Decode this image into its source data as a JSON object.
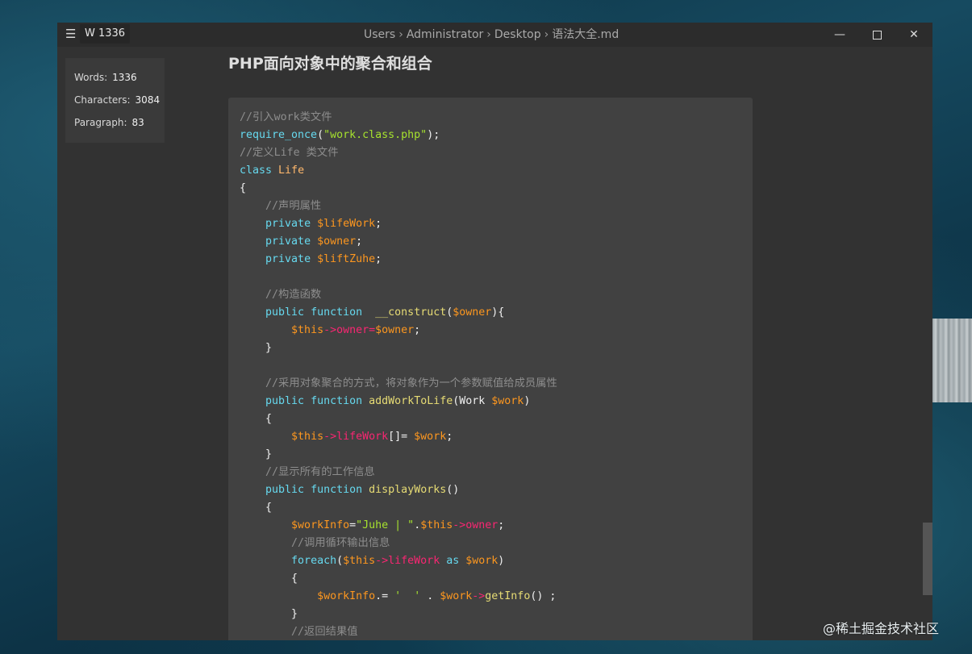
{
  "app": {
    "word_badge": "W 1336",
    "breadcrumb": [
      "Users",
      "Administrator",
      "Desktop",
      "语法大全.md"
    ],
    "breadcrumb_sep": "›"
  },
  "stats": {
    "words_label": "Words:",
    "words_value": "1336",
    "characters_label": "Characters:",
    "characters_value": "3084",
    "paragraph_label": "Paragraph:",
    "paragraph_value": "83"
  },
  "document": {
    "heading": "PHP面向对象中的聚合和组合",
    "code_lines": [
      [
        [
          "comment",
          "//引入work类文件"
        ]
      ],
      [
        [
          "keyword",
          "require_once"
        ],
        [
          "plain",
          "("
        ],
        [
          "string",
          "\"work.class.php\""
        ],
        [
          "plain",
          ");"
        ]
      ],
      [
        [
          "comment",
          "//定义Life 类文件"
        ]
      ],
      [
        [
          "keyword",
          "class"
        ],
        [
          "plain",
          " "
        ],
        [
          "class",
          "Life"
        ]
      ],
      [
        [
          "plain",
          "{"
        ]
      ],
      [
        [
          "plain",
          "    "
        ],
        [
          "comment",
          "//声明属性"
        ]
      ],
      [
        [
          "plain",
          "    "
        ],
        [
          "keyword",
          "private"
        ],
        [
          "plain",
          " "
        ],
        [
          "variable",
          "$lifeWork"
        ],
        [
          "plain",
          ";"
        ]
      ],
      [
        [
          "plain",
          "    "
        ],
        [
          "keyword",
          "private"
        ],
        [
          "plain",
          " "
        ],
        [
          "variable",
          "$owner"
        ],
        [
          "plain",
          ";"
        ]
      ],
      [
        [
          "plain",
          "    "
        ],
        [
          "keyword",
          "private"
        ],
        [
          "plain",
          " "
        ],
        [
          "variable",
          "$liftZuhe"
        ],
        [
          "plain",
          ";"
        ]
      ],
      [
        [
          "plain",
          ""
        ]
      ],
      [
        [
          "plain",
          "    "
        ],
        [
          "comment",
          "//构造函数"
        ]
      ],
      [
        [
          "plain",
          "    "
        ],
        [
          "keyword",
          "public"
        ],
        [
          "plain",
          " "
        ],
        [
          "keyword",
          "function"
        ],
        [
          "plain",
          "  "
        ],
        [
          "function",
          "__construct"
        ],
        [
          "plain",
          "("
        ],
        [
          "variable",
          "$owner"
        ],
        [
          "plain",
          "){"
        ]
      ],
      [
        [
          "plain",
          "        "
        ],
        [
          "variable",
          "$this"
        ],
        [
          "property",
          "->owner="
        ],
        [
          "variable",
          "$owner"
        ],
        [
          "plain",
          ";"
        ]
      ],
      [
        [
          "plain",
          "    }"
        ]
      ],
      [
        [
          "plain",
          ""
        ]
      ],
      [
        [
          "plain",
          "    "
        ],
        [
          "comment",
          "//采用对象聚合的方式，将对象作为一个参数赋值给成员属性"
        ]
      ],
      [
        [
          "plain",
          "    "
        ],
        [
          "keyword",
          "public"
        ],
        [
          "plain",
          " "
        ],
        [
          "keyword",
          "function"
        ],
        [
          "plain",
          " "
        ],
        [
          "function",
          "addWorkToLife"
        ],
        [
          "plain",
          "(Work "
        ],
        [
          "variable",
          "$work"
        ],
        [
          "plain",
          ")"
        ]
      ],
      [
        [
          "plain",
          "    {"
        ]
      ],
      [
        [
          "plain",
          "        "
        ],
        [
          "variable",
          "$this"
        ],
        [
          "property",
          "->lifeWork"
        ],
        [
          "plain",
          "[]= "
        ],
        [
          "variable",
          "$work"
        ],
        [
          "plain",
          ";"
        ]
      ],
      [
        [
          "plain",
          "    }"
        ]
      ],
      [
        [
          "plain",
          "    "
        ],
        [
          "comment",
          "//显示所有的工作信息"
        ]
      ],
      [
        [
          "plain",
          "    "
        ],
        [
          "keyword",
          "public"
        ],
        [
          "plain",
          " "
        ],
        [
          "keyword",
          "function"
        ],
        [
          "plain",
          " "
        ],
        [
          "function",
          "displayWorks"
        ],
        [
          "plain",
          "()"
        ]
      ],
      [
        [
          "plain",
          "    {"
        ]
      ],
      [
        [
          "plain",
          "        "
        ],
        [
          "variable",
          "$workInfo"
        ],
        [
          "plain",
          "="
        ],
        [
          "string",
          "\"Juhe | \""
        ],
        [
          "plain",
          "."
        ],
        [
          "variable",
          "$this"
        ],
        [
          "property",
          "->owner"
        ],
        [
          "plain",
          ";"
        ]
      ],
      [
        [
          "plain",
          "        "
        ],
        [
          "comment",
          "//调用循环输出信息"
        ]
      ],
      [
        [
          "plain",
          "        "
        ],
        [
          "keyword",
          "foreach"
        ],
        [
          "plain",
          "("
        ],
        [
          "variable",
          "$this"
        ],
        [
          "property",
          "->lifeWork"
        ],
        [
          "plain",
          " "
        ],
        [
          "keyword",
          "as"
        ],
        [
          "plain",
          " "
        ],
        [
          "variable",
          "$work"
        ],
        [
          "plain",
          ")"
        ]
      ],
      [
        [
          "plain",
          "        {"
        ]
      ],
      [
        [
          "plain",
          "            "
        ],
        [
          "variable",
          "$workInfo"
        ],
        [
          "plain",
          ".= "
        ],
        [
          "string",
          "'  '"
        ],
        [
          "plain",
          " . "
        ],
        [
          "variable",
          "$work"
        ],
        [
          "property",
          "->"
        ],
        [
          "function",
          "getInfo"
        ],
        [
          "plain",
          "() ;"
        ]
      ],
      [
        [
          "plain",
          "        }"
        ]
      ],
      [
        [
          "plain",
          "        "
        ],
        [
          "comment",
          "//返回结果值"
        ]
      ]
    ]
  },
  "watermark": "@稀土掘金技术社区"
}
